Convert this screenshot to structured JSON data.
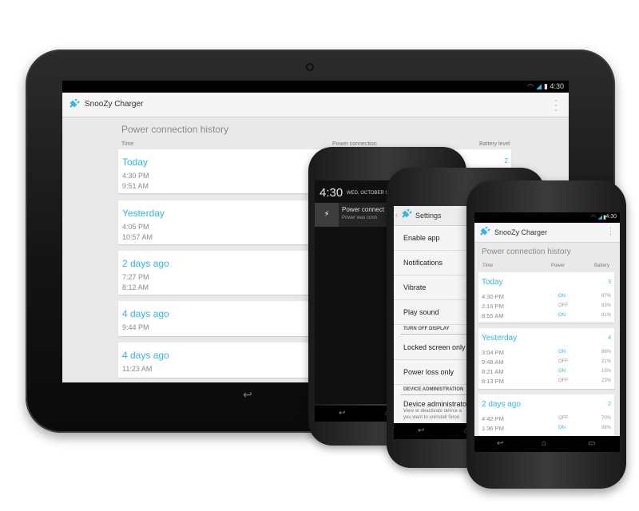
{
  "colors": {
    "accent": "#33b5e5",
    "bezel": "#1e1e1e",
    "screen_bg": "#e9e9e9"
  },
  "tablet": {
    "status": {
      "time": "4:30",
      "icons": [
        "wifi-icon",
        "signal-icon",
        "battery-icon"
      ]
    },
    "app_title": "SnooZy Charger",
    "heading": "Power connection history",
    "columns": {
      "time": "Time",
      "power": "Power connection",
      "battery": "Battery level"
    },
    "cards": [
      {
        "day": "Today",
        "times": [
          "4:30 PM",
          "9:51 AM"
        ],
        "count": "2"
      },
      {
        "day": "Yesterday",
        "times": [
          "4:05 PM",
          "10:57 AM"
        ]
      },
      {
        "day": "2 days ago",
        "times": [
          "7:27 PM",
          "8:12 AM"
        ]
      },
      {
        "day": "4 days ago",
        "times": [
          "9:44 PM"
        ]
      },
      {
        "day": "4 days ago",
        "times": [
          "11:23 AM"
        ]
      }
    ]
  },
  "phone_notification": {
    "time": "4:30",
    "date": "WED, OCTOBER 9",
    "notification": {
      "title": "Power connect",
      "subtitle": "Power was conn"
    }
  },
  "phone_settings": {
    "title": "Settings",
    "items": [
      "Enable app",
      "Notifications",
      "Vibrate",
      "Play sound"
    ],
    "section1": "TURN OFF DISPLAY",
    "items2": [
      "Locked screen only",
      "Power loss only"
    ],
    "section2": "DEVICE ADMINISTRATION",
    "admin": {
      "title": "Device administrator",
      "line1": "View or deactivate device a",
      "line2": "you want to uninstall Snoo"
    }
  },
  "phone_history": {
    "status": {
      "time": "4:30"
    },
    "app_title": "SnooZy Charger",
    "heading": "Power connection history",
    "columns": {
      "time": "Time",
      "power": "Power",
      "battery": "Battery"
    },
    "cards": [
      {
        "day": "Today",
        "count": "3",
        "rows": [
          {
            "time": "4:30 PM",
            "power": "ON",
            "pct": "67%"
          },
          {
            "time": "2:16 PM",
            "power": "OFF",
            "pct": "83%"
          },
          {
            "time": "8:55 AM",
            "power": "ON",
            "pct": "81%"
          }
        ]
      },
      {
        "day": "Yesterday",
        "count": "4",
        "rows": [
          {
            "time": "3:04 PM",
            "power": "ON",
            "pct": "86%"
          },
          {
            "time": "9:48 AM",
            "power": "OFF",
            "pct": "21%"
          },
          {
            "time": "8:21 AM",
            "power": "ON",
            "pct": "15%"
          },
          {
            "time": "8:13 PM",
            "power": "OFF",
            "pct": "23%"
          }
        ]
      },
      {
        "day": "2 days ago",
        "count": "2",
        "rows": [
          {
            "time": "4:42 PM",
            "power": "OFF",
            "pct": "70%"
          },
          {
            "time": "1:36 PM",
            "power": "ON",
            "pct": "98%"
          }
        ]
      }
    ]
  },
  "nav_icons": [
    "back-icon",
    "home-icon",
    "recents-icon"
  ]
}
